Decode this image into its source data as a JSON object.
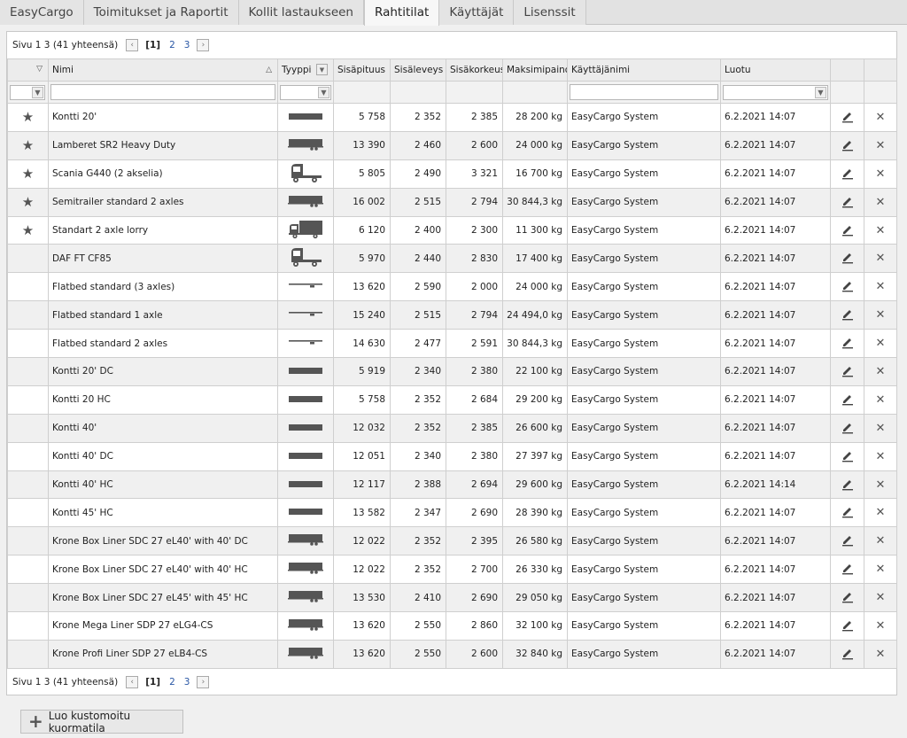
{
  "tabs": [
    {
      "label": "EasyCargo",
      "active": false
    },
    {
      "label": "Toimitukset ja Raportit",
      "active": false
    },
    {
      "label": "Kollit lastaukseen",
      "active": false
    },
    {
      "label": "Rahtitilat",
      "active": true
    },
    {
      "label": "Käyttäjät",
      "active": false
    },
    {
      "label": "Lisenssit",
      "active": false
    }
  ],
  "pager": {
    "info": "Sivu 1 3 (41 yhteensä)",
    "prev": "‹",
    "next": "›",
    "pages": [
      "[1]",
      "2",
      "3"
    ]
  },
  "columns": {
    "nimi": "Nimi",
    "tyyppi": "Tyyppi",
    "sisapituus": "Sisäpituus",
    "sisaleveys": "Sisäleveys",
    "sisakorkeus": "Sisäkorkeus",
    "maksimipaino": "Maksimipaino",
    "kayttajanimi": "Käyttäjänimi",
    "luotu": "Luotu"
  },
  "icons": {
    "favorite": "star-icon",
    "edit": "pencil-icon",
    "delete": "close-icon",
    "filter": "filter-icon",
    "sort": "sort-ascending-icon",
    "add": "plus-icon"
  },
  "rows": [
    {
      "fav": true,
      "name": "Kontti 20'",
      "type": "container",
      "len": "5 758",
      "wid": "2 352",
      "hei": "2 385",
      "max": "28 200 kg",
      "user": "EasyCargo System",
      "created": "6.2.2021 14:07"
    },
    {
      "fav": true,
      "name": "Lamberet SR2 Heavy Duty",
      "type": "trailer",
      "len": "13 390",
      "wid": "2 460",
      "hei": "2 600",
      "max": "24 000 kg",
      "user": "EasyCargo System",
      "created": "6.2.2021 14:07"
    },
    {
      "fav": true,
      "name": "Scania G440 (2 akselia)",
      "type": "tractor",
      "len": "5 805",
      "wid": "2 490",
      "hei": "3 321",
      "max": "16 700 kg",
      "user": "EasyCargo System",
      "created": "6.2.2021 14:07"
    },
    {
      "fav": true,
      "name": "Semitrailer standard 2 axles",
      "type": "trailer",
      "len": "16 002",
      "wid": "2 515",
      "hei": "2 794",
      "max": "30 844,3 kg",
      "user": "EasyCargo System",
      "created": "6.2.2021 14:07"
    },
    {
      "fav": true,
      "name": "Standart 2 axle lorry",
      "type": "lorry",
      "len": "6 120",
      "wid": "2 400",
      "hei": "2 300",
      "max": "11 300 kg",
      "user": "EasyCargo System",
      "created": "6.2.2021 14:07"
    },
    {
      "fav": false,
      "name": "DAF FT CF85",
      "type": "tractor",
      "len": "5 970",
      "wid": "2 440",
      "hei": "2 830",
      "max": "17 400 kg",
      "user": "EasyCargo System",
      "created": "6.2.2021 14:07"
    },
    {
      "fav": false,
      "name": "Flatbed standard (3 axles)",
      "type": "flatbed",
      "len": "13 620",
      "wid": "2 590",
      "hei": "2 000",
      "max": "24 000 kg",
      "user": "EasyCargo System",
      "created": "6.2.2021 14:07"
    },
    {
      "fav": false,
      "name": "Flatbed standard 1 axle",
      "type": "flatbed",
      "len": "15 240",
      "wid": "2 515",
      "hei": "2 794",
      "max": "24 494,0 kg",
      "user": "EasyCargo System",
      "created": "6.2.2021 14:07"
    },
    {
      "fav": false,
      "name": "Flatbed standard 2 axles",
      "type": "flatbed",
      "len": "14 630",
      "wid": "2 477",
      "hei": "2 591",
      "max": "30 844,3 kg",
      "user": "EasyCargo System",
      "created": "6.2.2021 14:07"
    },
    {
      "fav": false,
      "name": "Kontti 20' DC",
      "type": "container",
      "len": "5 919",
      "wid": "2 340",
      "hei": "2 380",
      "max": "22 100 kg",
      "user": "EasyCargo System",
      "created": "6.2.2021 14:07"
    },
    {
      "fav": false,
      "name": "Kontti 20 HC",
      "type": "container",
      "len": "5 758",
      "wid": "2 352",
      "hei": "2 684",
      "max": "29 200 kg",
      "user": "EasyCargo System",
      "created": "6.2.2021 14:07"
    },
    {
      "fav": false,
      "name": "Kontti 40'",
      "type": "container",
      "len": "12 032",
      "wid": "2 352",
      "hei": "2 385",
      "max": "26 600 kg",
      "user": "EasyCargo System",
      "created": "6.2.2021 14:07"
    },
    {
      "fav": false,
      "name": "Kontti 40' DC",
      "type": "container",
      "len": "12 051",
      "wid": "2 340",
      "hei": "2 380",
      "max": "27 397 kg",
      "user": "EasyCargo System",
      "created": "6.2.2021 14:07"
    },
    {
      "fav": false,
      "name": "Kontti 40' HC",
      "type": "container",
      "len": "12 117",
      "wid": "2 388",
      "hei": "2 694",
      "max": "29 600 kg",
      "user": "EasyCargo System",
      "created": "6.2.2021 14:14"
    },
    {
      "fav": false,
      "name": "Kontti 45' HC",
      "type": "container",
      "len": "13 582",
      "wid": "2 347",
      "hei": "2 690",
      "max": "28 390 kg",
      "user": "EasyCargo System",
      "created": "6.2.2021 14:07"
    },
    {
      "fav": false,
      "name": "Krone Box Liner SDC 27 eL40' with 40' DC",
      "type": "trailer",
      "len": "12 022",
      "wid": "2 352",
      "hei": "2 395",
      "max": "26 580 kg",
      "user": "EasyCargo System",
      "created": "6.2.2021 14:07"
    },
    {
      "fav": false,
      "name": "Krone Box Liner SDC 27 eL40' with 40' HC",
      "type": "trailer",
      "len": "12 022",
      "wid": "2 352",
      "hei": "2 700",
      "max": "26 330 kg",
      "user": "EasyCargo System",
      "created": "6.2.2021 14:07"
    },
    {
      "fav": false,
      "name": "Krone Box Liner SDC 27 eL45' with 45' HC",
      "type": "trailer",
      "len": "13 530",
      "wid": "2 410",
      "hei": "2 690",
      "max": "29 050 kg",
      "user": "EasyCargo System",
      "created": "6.2.2021 14:07"
    },
    {
      "fav": false,
      "name": "Krone Mega Liner SDP 27 eLG4-CS",
      "type": "trailer",
      "len": "13 620",
      "wid": "2 550",
      "hei": "2 860",
      "max": "32 100 kg",
      "user": "EasyCargo System",
      "created": "6.2.2021 14:07"
    },
    {
      "fav": false,
      "name": "Krone Profi Liner SDP 27 eLB4-CS",
      "type": "trailer",
      "len": "13 620",
      "wid": "2 550",
      "hei": "2 600",
      "max": "32 840 kg",
      "user": "EasyCargo System",
      "created": "6.2.2021 14:07"
    }
  ],
  "create_button": "Luo kustomoitu kuormatila"
}
